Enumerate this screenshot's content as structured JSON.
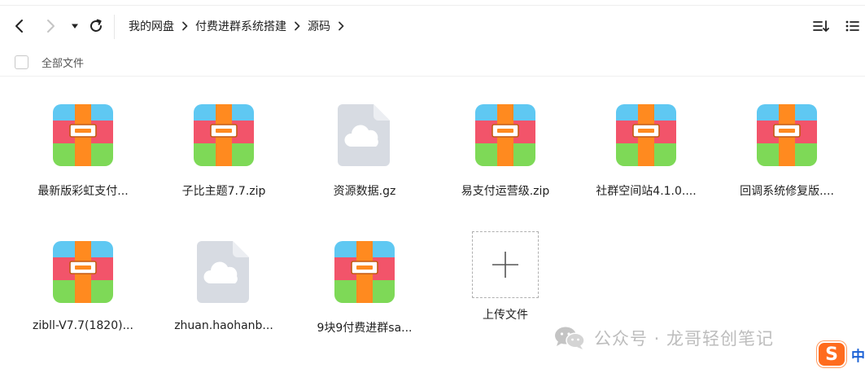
{
  "toolbar": {
    "back_icon": "chevron-left-icon",
    "forward_icon": "chevron-right-icon",
    "history_icon": "caret-down-icon",
    "refresh_icon": "refresh-icon",
    "sort_icon": "sort-icon",
    "list_view_icon": "list-view-icon"
  },
  "breadcrumb": [
    {
      "label": "我的网盘"
    },
    {
      "label": "付费进群系统搭建"
    },
    {
      "label": "源码"
    }
  ],
  "select_all": {
    "label": "全部文件",
    "checked": false
  },
  "files": [
    {
      "name": "最新版彩虹支付...",
      "type": "zip"
    },
    {
      "name": "子比主题7.7.zip",
      "type": "zip"
    },
    {
      "name": "资源数据.gz",
      "type": "cloud"
    },
    {
      "name": "易支付运营级.zip",
      "type": "zip"
    },
    {
      "name": "社群空间站4.1.0....",
      "type": "zip"
    },
    {
      "name": "回调系统修复版....",
      "type": "zip"
    },
    {
      "name": "zibll-V7.7(1820)...",
      "type": "zip"
    },
    {
      "name": "zhuan.haohanb...",
      "type": "cloud"
    },
    {
      "name": "9块9付费进群sa...",
      "type": "zip"
    }
  ],
  "upload": {
    "label": "上传文件",
    "icon": "plus-icon"
  },
  "watermark": {
    "text": "公众号 · 龙哥轻创笔记",
    "icon": "wechat-icon"
  },
  "ime": {
    "logo": "S",
    "mode": "中",
    "color": "#ff6c1e"
  },
  "colors": {
    "zip_blue": "#5fc8f2",
    "zip_red": "#f2546a",
    "zip_green": "#7ed957",
    "zip_orange": "#ff8a1f",
    "cloud_bg": "#d7dbe2",
    "cloud_fold": "#eceef2",
    "cloud_fill": "#ffffff"
  }
}
